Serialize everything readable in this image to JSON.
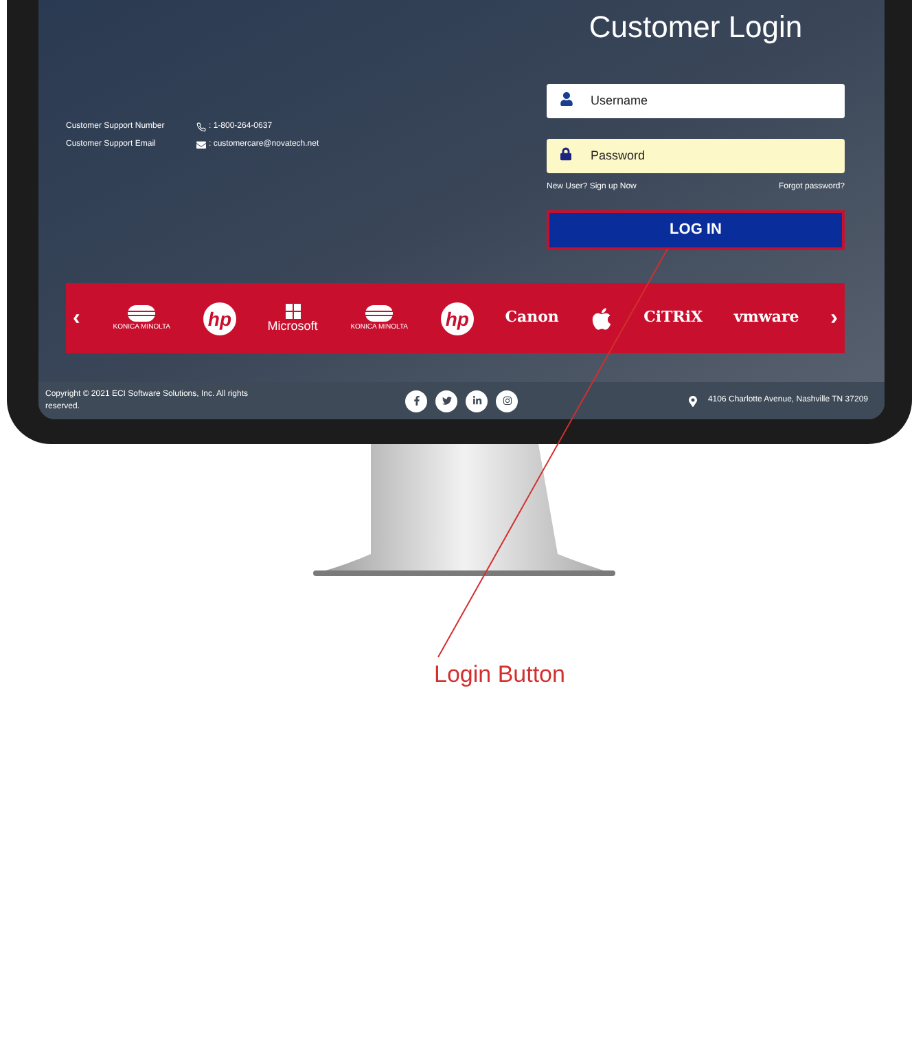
{
  "screen": {
    "contacts": [
      {
        "kind": "phone",
        "label": "Customer Support Number",
        "value": ": 1-800-264-0637"
      },
      {
        "kind": "email",
        "label": "Customer Support Email",
        "value": ": customercare@novatech.net"
      }
    ],
    "login": {
      "title": "Customer Login",
      "fields": [
        {
          "kind": "username",
          "placeholder": "Username"
        },
        {
          "kind": "password",
          "placeholder": "Password"
        }
      ],
      "links": [
        "New User? Sign up Now",
        "Forgot password?"
      ],
      "button": "LOG IN"
    },
    "carousel": {
      "prev": "‹",
      "next": "›",
      "logos": [
        {
          "kind": "oval",
          "text": "KONICA MINOLTA"
        },
        {
          "kind": "round",
          "text": "hp"
        },
        {
          "kind": "grid",
          "text": "Microsoft"
        },
        {
          "kind": "oval",
          "text": "KONICA MINOLTA"
        },
        {
          "kind": "round",
          "text": "hp"
        },
        {
          "kind": "word",
          "text": "Canon"
        },
        {
          "kind": "apple"
        },
        {
          "kind": "word",
          "text": "CiTRiX"
        },
        {
          "kind": "word",
          "text": "vmware"
        }
      ]
    },
    "footer": {
      "copyright": "Copyright © 2021 ECI Software Solutions, Inc. All rights reserved.",
      "social": [
        {
          "kind": "facebook"
        },
        {
          "kind": "twitter"
        },
        {
          "kind": "linkedin"
        },
        {
          "kind": "instagram"
        }
      ],
      "address": "4106 Charlotte Avenue, Nashville TN 37209"
    }
  },
  "annotation": {
    "label": "Login Button"
  }
}
